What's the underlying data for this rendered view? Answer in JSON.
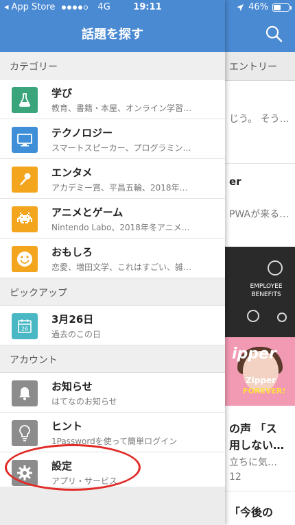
{
  "status_bar": {
    "carrier": "App Store",
    "network": "4G",
    "time": "19:11",
    "battery": "46%",
    "battery_level": 0.46
  },
  "drawer": {
    "title": "話題を探す",
    "sections": [
      {
        "label": "カテゴリー",
        "items": [
          {
            "title": "学び",
            "subtitle": "教育、書籍・本屋、オンライン学習…",
            "icon": "flask-icon",
            "color": "#3aa57a"
          },
          {
            "title": "テクノロジー",
            "subtitle": "スマートスピーカー、プログラミン…",
            "icon": "monitor-icon",
            "color": "#3f8fd8"
          },
          {
            "title": "エンタメ",
            "subtitle": "アカデミー賞、平昌五輪、2018年…",
            "icon": "microphone-icon",
            "color": "#f3a51d"
          },
          {
            "title": "アニメとゲーム",
            "subtitle": "Nintendo Labo、2018年冬アニメ…",
            "icon": "invader-icon",
            "color": "#f3a51d"
          },
          {
            "title": "おもしろ",
            "subtitle": "恋愛、増田文学、これはすごい、雑…",
            "icon": "smile-icon",
            "color": "#f3a51d"
          }
        ]
      },
      {
        "label": "ピックアップ",
        "items": [
          {
            "title": "3月26日",
            "subtitle": "過去のこの日",
            "icon": "calendar-icon",
            "color": "#4ab8c4",
            "icon_text": "26"
          }
        ]
      },
      {
        "label": "アカウント",
        "items": [
          {
            "title": "お知らせ",
            "subtitle": "はてなのお知らせ",
            "icon": "bell-icon",
            "color": "#8c8c8c"
          },
          {
            "title": "ヒント",
            "subtitle": "1Passwordを使って簡単ログイン",
            "icon": "lightbulb-icon",
            "color": "#8c8c8c"
          },
          {
            "title": "設定",
            "subtitle": "アプリ・サービス",
            "icon": "gear-icon",
            "color": "#8c8c8c"
          }
        ]
      }
    ]
  },
  "background": {
    "subheader": "エントリー",
    "snippets": [
      "じう。 そう…",
      "er",
      "PWAが来る…",
      "の声 「ス",
      "用しない…",
      "立ちに気…",
      "12",
      "「今後の"
    ],
    "image1_text": "EMPLOYEE BENEFITS",
    "image2_heading": "ipper",
    "image2_line1": "Zipper",
    "image2_line2": "FOREVER!"
  },
  "colors": {
    "header": "#4a8ad3",
    "highlight": "#e12a26"
  }
}
